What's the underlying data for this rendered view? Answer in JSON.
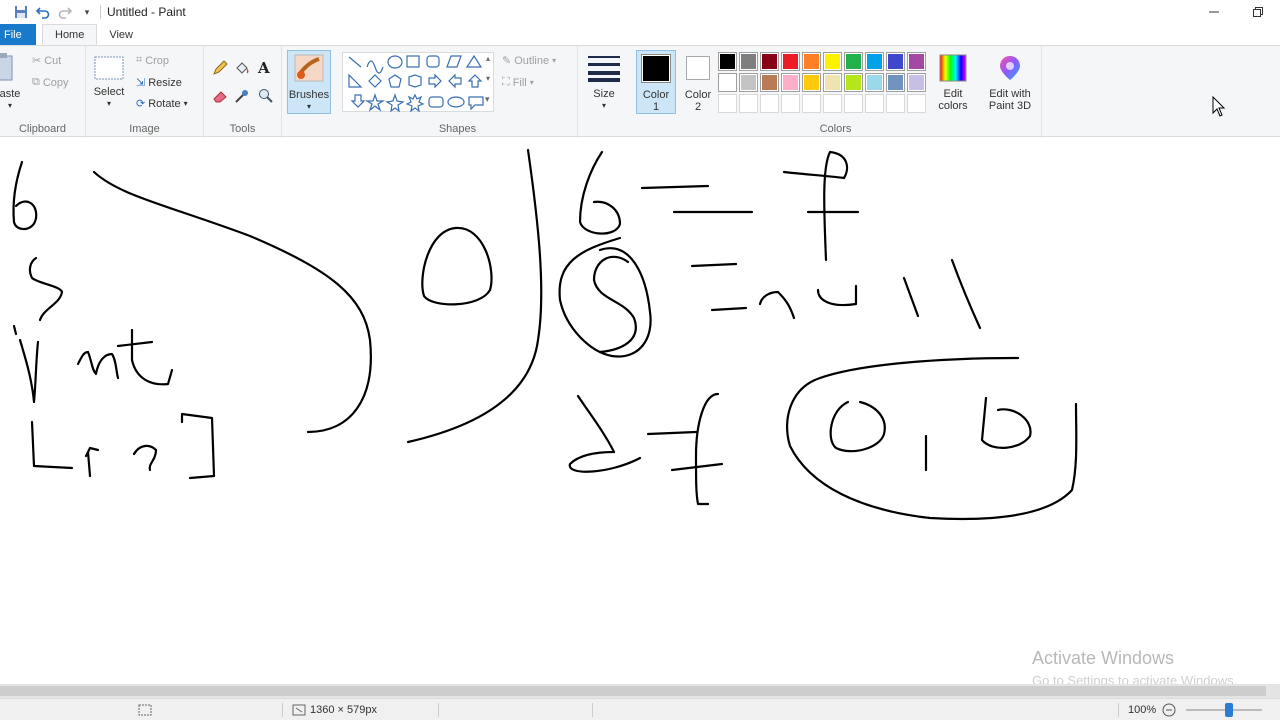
{
  "window": {
    "title": "Untitled - Paint",
    "minimize_icon": "minimize-icon",
    "restore_icon": "restore-icon"
  },
  "tabs": [
    {
      "label": "File"
    },
    {
      "label": "Home"
    },
    {
      "label": "View"
    }
  ],
  "ribbon": {
    "clipboard": {
      "paste_label": "aste",
      "cut_label": "Cut",
      "copy_label": "Copy",
      "group_label": "Clipboard"
    },
    "image": {
      "select_label": "Select",
      "crop_label": "Crop",
      "resize_label": "Resize",
      "rotate_label": "Rotate",
      "group_label": "Image"
    },
    "tools": {
      "group_label": "Tools"
    },
    "brushes": {
      "label": "Brushes"
    },
    "shapes": {
      "outline_label": "Outline",
      "fill_label": "Fill",
      "group_label": "Shapes"
    },
    "size": {
      "label": "Size"
    },
    "colors": {
      "color1_label": "Color",
      "color1_num": "1",
      "color2_label": "Color",
      "color2_num": "2",
      "edit_colors_label1": "Edit",
      "edit_colors_label2": "colors",
      "paint3d_label1": "Edit with",
      "paint3d_label2": "Paint 3D",
      "group_label": "Colors",
      "color1_value": "#000000",
      "color2_value": "#ffffff",
      "palette_row1": [
        "#000000",
        "#7f7f7f",
        "#880015",
        "#ed1c24",
        "#ff7f27",
        "#fff200",
        "#22b14c",
        "#00a2e8",
        "#3f48cc",
        "#a349a4"
      ],
      "palette_row2": [
        "#ffffff",
        "#c3c3c3",
        "#b97a57",
        "#ffaec9",
        "#ffc90e",
        "#efe4b0",
        "#b5e61d",
        "#99d9ea",
        "#7092be",
        "#c8bfe7"
      ]
    }
  },
  "status": {
    "canvas_size": "1360 × 579px",
    "zoom": "100%"
  },
  "watermark": {
    "line1": "Activate Windows",
    "line2": "Go to Settings to activate Windows."
  }
}
